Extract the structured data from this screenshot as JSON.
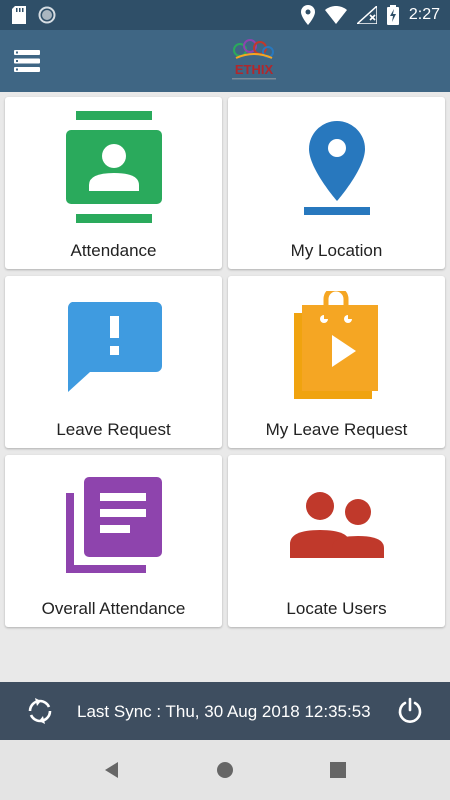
{
  "status_bar": {
    "time": "2:27",
    "icons": [
      "sd-card-icon",
      "circle-icon",
      "location-icon",
      "wifi-icon",
      "no-signal-icon",
      "battery-charging-icon"
    ]
  },
  "app_bar": {
    "menu_icon": "menu-icon",
    "logo_text": "ETHIX"
  },
  "tiles": [
    {
      "label": "Attendance",
      "icon": "contact-card-icon",
      "color": "#2aaa5c"
    },
    {
      "label": "My Location",
      "icon": "map-pin-icon",
      "color": "#2878be"
    },
    {
      "label": "Leave Request",
      "icon": "chat-alert-icon",
      "color": "#3f9be0"
    },
    {
      "label": "My Leave Request",
      "icon": "shopping-bag-play-icon",
      "color": "#f5a623"
    },
    {
      "label": "Overall Attendance",
      "icon": "document-stack-icon",
      "color": "#8e44ad"
    },
    {
      "label": "Locate Users",
      "icon": "users-icon",
      "color": "#c0392b"
    }
  ],
  "footer": {
    "sync_text": "Last Sync : Thu, 30 Aug 2018 12:35:53",
    "sync_icon": "sync-icon",
    "power_icon": "power-icon"
  },
  "nav_bar": {
    "icons": [
      "back-icon",
      "home-icon",
      "recents-icon"
    ]
  }
}
